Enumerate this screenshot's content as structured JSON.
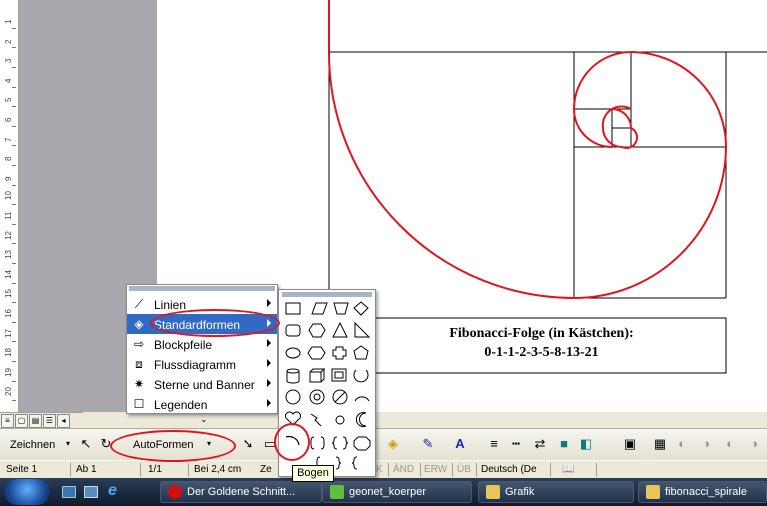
{
  "document": {
    "ruler_numbers": [
      "1",
      "2",
      "3",
      "4",
      "5",
      "6",
      "7",
      "8",
      "9",
      "10",
      "11",
      "12",
      "13",
      "14",
      "15",
      "16",
      "17",
      "18",
      "19",
      "20"
    ],
    "caption_line1": "Fibonacci-Folge (in Kästchen):",
    "caption_line2": "0-1-1-2-3-5-8-13-21"
  },
  "autoshapes_menu": {
    "items": [
      {
        "label": "Linien",
        "icon": "lines-icon"
      },
      {
        "label": "Standardformen",
        "icon": "basic-shapes-icon"
      },
      {
        "label": "Blockpfeile",
        "icon": "block-arrows-icon"
      },
      {
        "label": "Flussdiagramm",
        "icon": "flowchart-icon"
      },
      {
        "label": "Sterne und Banner",
        "icon": "stars-banners-icon"
      },
      {
        "label": "Legenden",
        "icon": "callouts-icon"
      }
    ],
    "more_indicator": "⌄"
  },
  "tooltip": "Bogen",
  "draw_toolbar": {
    "draw_label": "Zeichnen",
    "autoshapes_label": "AutoFormen"
  },
  "status_bar": {
    "page": "Seite  1",
    "section": "Ab  1",
    "page_of": "1/1",
    "position": "Bei  2,4 cm",
    "line": "Ze",
    "ext": "ERW",
    "trk": "ÄND",
    "ovr": "ÜB",
    "language": "Deutsch (De",
    "mac": "K"
  },
  "taskbar": {
    "tasks": [
      {
        "label": "Der Goldene Schnitt...",
        "icon": "opera-icon"
      },
      {
        "label": "geonet_koerper",
        "icon": "app-icon"
      },
      {
        "label": "Grafik",
        "icon": "folder-icon"
      },
      {
        "label": "fibonacci_spirale",
        "icon": "folder-icon"
      }
    ]
  },
  "colors": {
    "spiral": "#e2141c",
    "highlight": "#316ac5",
    "annotation": "#e2141c"
  }
}
